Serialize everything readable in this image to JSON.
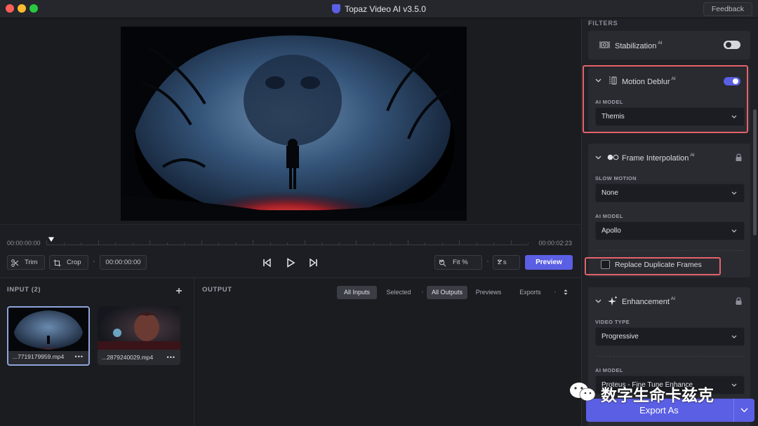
{
  "window": {
    "title": "Topaz Video AI  v3.5.0",
    "feedback_label": "Feedback"
  },
  "timeline": {
    "start_time": "00:00:00:00",
    "end_time": "00:00:02:23",
    "trim_label": "Trim",
    "crop_label": "Crop",
    "current_time": "00:00:00:00",
    "fit_label": "Fit %",
    "step_label": "2 s",
    "preview_label": "Preview"
  },
  "input": {
    "title": "INPUT (2)",
    "add_icon": "plus-icon",
    "files": [
      {
        "name": "...7719179959.mp4",
        "more": "•••",
        "selected": true
      },
      {
        "name": "...2879240029.mp4",
        "more": "•••",
        "selected": false
      }
    ]
  },
  "output": {
    "title": "OUTPUT",
    "filter_tabs": [
      {
        "label": "All Inputs",
        "active": true
      },
      {
        "label": "Selected",
        "active": false
      }
    ],
    "view_tabs": [
      {
        "label": "All Outputs",
        "active": true
      },
      {
        "label": "Previews",
        "active": false
      },
      {
        "label": "Exports",
        "active": false
      }
    ]
  },
  "sidebar": {
    "header": "FILTERS",
    "stabilization": {
      "label": "Stabilization",
      "ai_badge": "AI",
      "enabled": false
    },
    "motion_deblur": {
      "label": "Motion Deblur",
      "ai_badge": "AI",
      "enabled": true,
      "model_label": "AI MODEL",
      "model_value": "Themis"
    },
    "frame_interpolation": {
      "label": "Frame Interpolation",
      "ai_badge": "AI",
      "locked": true,
      "slow_motion_label": "SLOW MOTION",
      "slow_motion_value": "None",
      "model_label": "AI MODEL",
      "model_value": "Apollo",
      "replace_duplicates_label": "Replace Duplicate Frames",
      "replace_duplicates_checked": false
    },
    "enhancement": {
      "label": "Enhancement",
      "ai_badge": "AI",
      "locked": true,
      "video_type_label": "VIDEO TYPE",
      "video_type_value": "Progressive",
      "model_label": "AI MODEL",
      "model_value": "Proteus - Fine Tune Enhance"
    },
    "export_label": "Export As"
  },
  "watermark": {
    "text": "数字生命卡兹克"
  },
  "colors": {
    "accent": "#5a5fe4",
    "highlight": "#e3636b",
    "background": "#1b1c20",
    "panel": "#2a2b31"
  }
}
